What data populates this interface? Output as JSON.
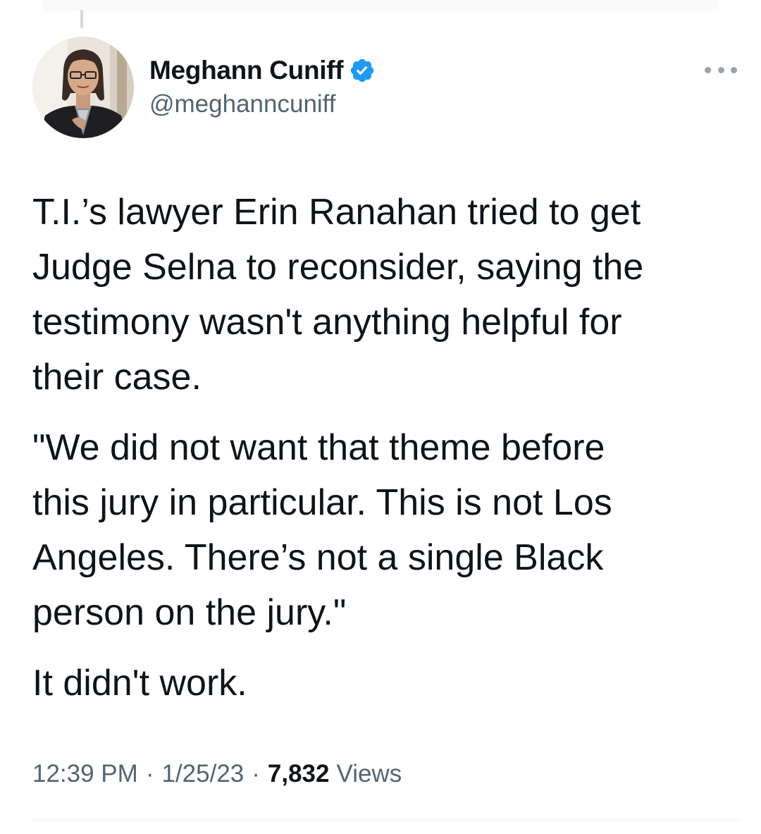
{
  "author": {
    "display_name": "Meghann Cuniff",
    "handle": "@meghanncuniff",
    "verified": true,
    "verified_color": "#1d9bf0"
  },
  "tweet": {
    "paragraphs": [
      "T.I.’s lawyer Erin Ranahan tried to get\nJudge Selna to reconsider, saying the\ntestimony wasn't anything helpful for\ntheir case.",
      "\"We did not want that theme before\nthis jury in particular. This is not Los\nAngeles. There’s not a single Black\nperson on the jury.\"",
      "It didn't work."
    ]
  },
  "meta": {
    "time": "12:39 PM",
    "separator": "·",
    "date": "1/25/23",
    "views_count": "7,832",
    "views_label": "Views"
  },
  "icons": {
    "more": "more-horizontal-icon",
    "verified": "verified-badge-icon"
  },
  "colors": {
    "text_primary": "#0f1419",
    "text_secondary": "#536471",
    "accent": "#1d9bf0"
  }
}
